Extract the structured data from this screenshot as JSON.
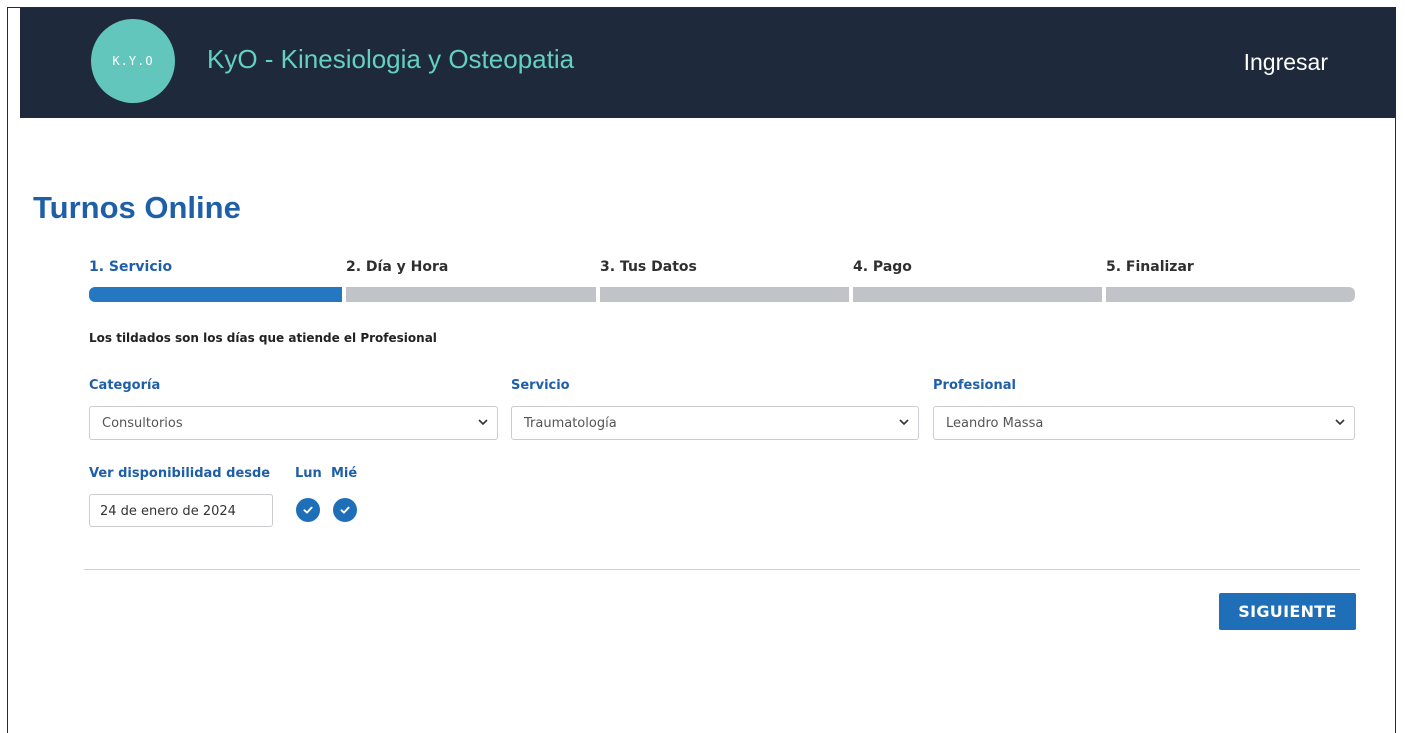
{
  "header": {
    "logo_text": "K.Y.O",
    "brand": "KyO - Kinesiologia y Osteopatia",
    "login_label": "Ingresar"
  },
  "page": {
    "title": "Turnos Online"
  },
  "steps": [
    {
      "label": "1. Servicio",
      "active": true
    },
    {
      "label": "2. Día y Hora",
      "active": false
    },
    {
      "label": "3. Tus Datos",
      "active": false
    },
    {
      "label": "4. Pago",
      "active": false
    },
    {
      "label": "5. Finalizar",
      "active": false
    }
  ],
  "note": "Los tildados son los días que atiende el Profesional",
  "fields": {
    "categoria": {
      "label": "Categoría",
      "value": "Consultorios"
    },
    "servicio": {
      "label": "Servicio",
      "value": "Traumatología"
    },
    "profesional": {
      "label": "Profesional",
      "value": "Leandro Massa"
    }
  },
  "availability": {
    "label": "Ver disponibilidad desde",
    "date": "24 de enero de 2024",
    "days": [
      {
        "label": "Lun",
        "checked": true
      },
      {
        "label": "Mié",
        "checked": true
      }
    ]
  },
  "actions": {
    "next_label": "SIGUIENTE"
  },
  "colors": {
    "header_bg": "#1e2a3b",
    "brand_teal": "#64cfc4",
    "primary_blue": "#1f6fb8",
    "progress_gray": "#c0c4c8"
  }
}
